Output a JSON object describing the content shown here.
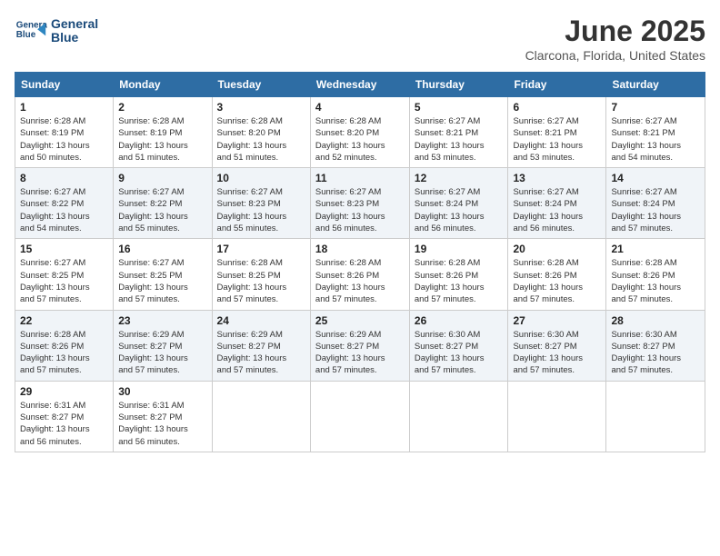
{
  "header": {
    "logo_line1": "General",
    "logo_line2": "Blue",
    "month": "June 2025",
    "location": "Clarcona, Florida, United States"
  },
  "weekdays": [
    "Sunday",
    "Monday",
    "Tuesday",
    "Wednesday",
    "Thursday",
    "Friday",
    "Saturday"
  ],
  "weeks": [
    [
      {
        "day": "1",
        "info": "Sunrise: 6:28 AM\nSunset: 8:19 PM\nDaylight: 13 hours\nand 50 minutes."
      },
      {
        "day": "2",
        "info": "Sunrise: 6:28 AM\nSunset: 8:19 PM\nDaylight: 13 hours\nand 51 minutes."
      },
      {
        "day": "3",
        "info": "Sunrise: 6:28 AM\nSunset: 8:20 PM\nDaylight: 13 hours\nand 51 minutes."
      },
      {
        "day": "4",
        "info": "Sunrise: 6:28 AM\nSunset: 8:20 PM\nDaylight: 13 hours\nand 52 minutes."
      },
      {
        "day": "5",
        "info": "Sunrise: 6:27 AM\nSunset: 8:21 PM\nDaylight: 13 hours\nand 53 minutes."
      },
      {
        "day": "6",
        "info": "Sunrise: 6:27 AM\nSunset: 8:21 PM\nDaylight: 13 hours\nand 53 minutes."
      },
      {
        "day": "7",
        "info": "Sunrise: 6:27 AM\nSunset: 8:21 PM\nDaylight: 13 hours\nand 54 minutes."
      }
    ],
    [
      {
        "day": "8",
        "info": "Sunrise: 6:27 AM\nSunset: 8:22 PM\nDaylight: 13 hours\nand 54 minutes."
      },
      {
        "day": "9",
        "info": "Sunrise: 6:27 AM\nSunset: 8:22 PM\nDaylight: 13 hours\nand 55 minutes."
      },
      {
        "day": "10",
        "info": "Sunrise: 6:27 AM\nSunset: 8:23 PM\nDaylight: 13 hours\nand 55 minutes."
      },
      {
        "day": "11",
        "info": "Sunrise: 6:27 AM\nSunset: 8:23 PM\nDaylight: 13 hours\nand 56 minutes."
      },
      {
        "day": "12",
        "info": "Sunrise: 6:27 AM\nSunset: 8:24 PM\nDaylight: 13 hours\nand 56 minutes."
      },
      {
        "day": "13",
        "info": "Sunrise: 6:27 AM\nSunset: 8:24 PM\nDaylight: 13 hours\nand 56 minutes."
      },
      {
        "day": "14",
        "info": "Sunrise: 6:27 AM\nSunset: 8:24 PM\nDaylight: 13 hours\nand 57 minutes."
      }
    ],
    [
      {
        "day": "15",
        "info": "Sunrise: 6:27 AM\nSunset: 8:25 PM\nDaylight: 13 hours\nand 57 minutes."
      },
      {
        "day": "16",
        "info": "Sunrise: 6:27 AM\nSunset: 8:25 PM\nDaylight: 13 hours\nand 57 minutes."
      },
      {
        "day": "17",
        "info": "Sunrise: 6:28 AM\nSunset: 8:25 PM\nDaylight: 13 hours\nand 57 minutes."
      },
      {
        "day": "18",
        "info": "Sunrise: 6:28 AM\nSunset: 8:26 PM\nDaylight: 13 hours\nand 57 minutes."
      },
      {
        "day": "19",
        "info": "Sunrise: 6:28 AM\nSunset: 8:26 PM\nDaylight: 13 hours\nand 57 minutes."
      },
      {
        "day": "20",
        "info": "Sunrise: 6:28 AM\nSunset: 8:26 PM\nDaylight: 13 hours\nand 57 minutes."
      },
      {
        "day": "21",
        "info": "Sunrise: 6:28 AM\nSunset: 8:26 PM\nDaylight: 13 hours\nand 57 minutes."
      }
    ],
    [
      {
        "day": "22",
        "info": "Sunrise: 6:28 AM\nSunset: 8:26 PM\nDaylight: 13 hours\nand 57 minutes."
      },
      {
        "day": "23",
        "info": "Sunrise: 6:29 AM\nSunset: 8:27 PM\nDaylight: 13 hours\nand 57 minutes."
      },
      {
        "day": "24",
        "info": "Sunrise: 6:29 AM\nSunset: 8:27 PM\nDaylight: 13 hours\nand 57 minutes."
      },
      {
        "day": "25",
        "info": "Sunrise: 6:29 AM\nSunset: 8:27 PM\nDaylight: 13 hours\nand 57 minutes."
      },
      {
        "day": "26",
        "info": "Sunrise: 6:30 AM\nSunset: 8:27 PM\nDaylight: 13 hours\nand 57 minutes."
      },
      {
        "day": "27",
        "info": "Sunrise: 6:30 AM\nSunset: 8:27 PM\nDaylight: 13 hours\nand 57 minutes."
      },
      {
        "day": "28",
        "info": "Sunrise: 6:30 AM\nSunset: 8:27 PM\nDaylight: 13 hours\nand 57 minutes."
      }
    ],
    [
      {
        "day": "29",
        "info": "Sunrise: 6:31 AM\nSunset: 8:27 PM\nDaylight: 13 hours\nand 56 minutes."
      },
      {
        "day": "30",
        "info": "Sunrise: 6:31 AM\nSunset: 8:27 PM\nDaylight: 13 hours\nand 56 minutes."
      },
      {
        "day": "",
        "info": ""
      },
      {
        "day": "",
        "info": ""
      },
      {
        "day": "",
        "info": ""
      },
      {
        "day": "",
        "info": ""
      },
      {
        "day": "",
        "info": ""
      }
    ]
  ]
}
